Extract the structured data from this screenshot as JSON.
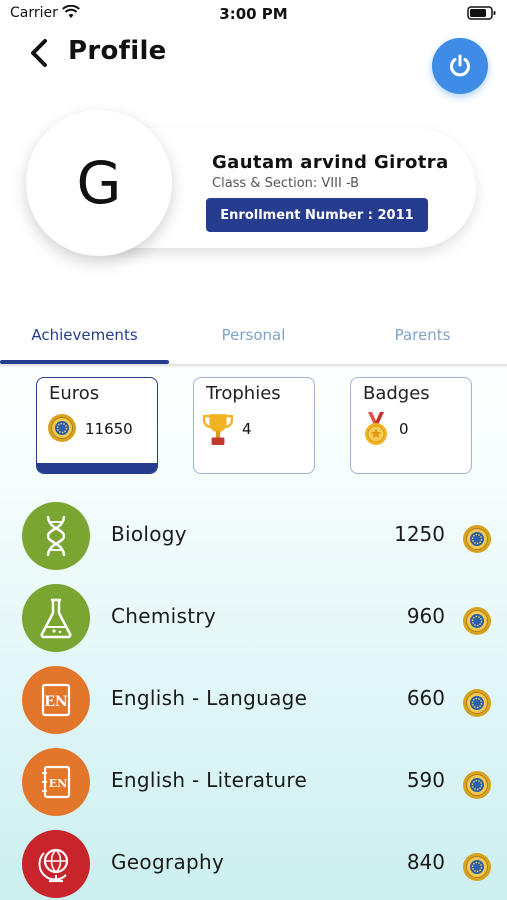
{
  "status_bar": {
    "carrier": "Carrier",
    "time": "3:00 PM"
  },
  "header": {
    "title": "Profile"
  },
  "profile": {
    "initial": "G",
    "name": "Gautam arvind Girotra",
    "class_section": "Class & Section: VIII -B",
    "enrollment": "Enrollment Number : 2011"
  },
  "tabs": [
    {
      "label": "Achievements",
      "active": true
    },
    {
      "label": "Personal",
      "active": false
    },
    {
      "label": "Parents",
      "active": false
    }
  ],
  "stats": [
    {
      "label": "Euros",
      "value": "11650",
      "icon": "coin-icon"
    },
    {
      "label": "Trophies",
      "value": "4",
      "icon": "trophy-icon"
    },
    {
      "label": "Badges",
      "value": "0",
      "icon": "medal-icon"
    }
  ],
  "subjects": [
    {
      "name": "Biology",
      "score": "1250",
      "color": "#7aa530",
      "icon": "dna-icon"
    },
    {
      "name": "Chemistry",
      "score": "960",
      "color": "#7aa530",
      "icon": "flask-icon"
    },
    {
      "name": "English - Language",
      "score": "660",
      "color": "#e2772c",
      "icon": "en-book-icon"
    },
    {
      "name": "English - Literature",
      "score": "590",
      "color": "#e2772c",
      "icon": "en-notebook-icon"
    },
    {
      "name": "Geography",
      "score": "840",
      "color": "#c8242b",
      "icon": "globe-icon"
    }
  ],
  "colors": {
    "primary": "#263d8f",
    "power": "#3f8ce6",
    "tab_inactive": "#7fa3c8"
  }
}
